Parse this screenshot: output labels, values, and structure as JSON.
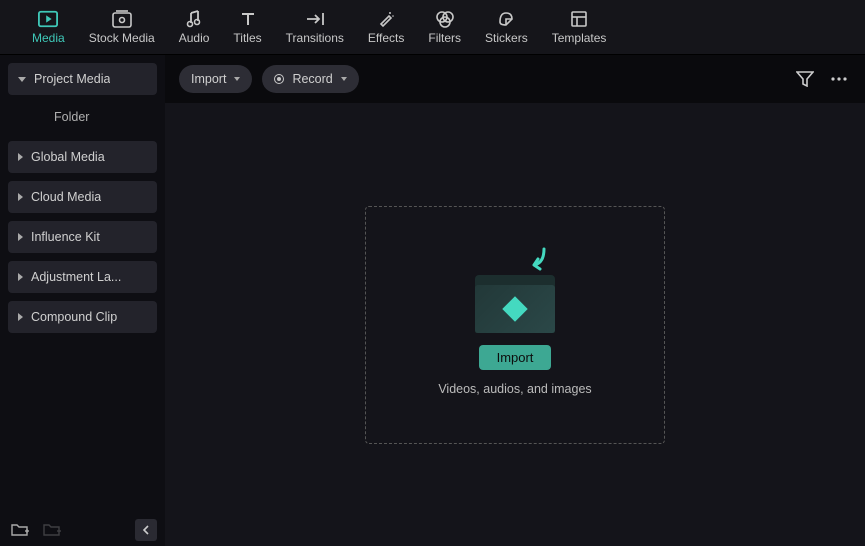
{
  "topTabs": [
    {
      "id": "media",
      "label": "Media"
    },
    {
      "id": "stock",
      "label": "Stock Media"
    },
    {
      "id": "audio",
      "label": "Audio"
    },
    {
      "id": "titles",
      "label": "Titles"
    },
    {
      "id": "transitions",
      "label": "Transitions"
    },
    {
      "id": "effects",
      "label": "Effects"
    },
    {
      "id": "filters",
      "label": "Filters"
    },
    {
      "id": "stickers",
      "label": "Stickers"
    },
    {
      "id": "templates",
      "label": "Templates"
    }
  ],
  "activeTab": "media",
  "sidebar": {
    "items": [
      {
        "label": "Project Media",
        "expanded": true,
        "children": [
          {
            "label": "Folder"
          }
        ]
      },
      {
        "label": "Global Media",
        "expanded": false
      },
      {
        "label": "Cloud Media",
        "expanded": false
      },
      {
        "label": "Influence Kit",
        "expanded": false
      },
      {
        "label": "Adjustment La...",
        "expanded": false
      },
      {
        "label": "Compound Clip",
        "expanded": false
      }
    ]
  },
  "toolbar": {
    "importLabel": "Import",
    "recordLabel": "Record"
  },
  "dropzone": {
    "buttonLabel": "Import",
    "hint": "Videos, audios, and images"
  }
}
